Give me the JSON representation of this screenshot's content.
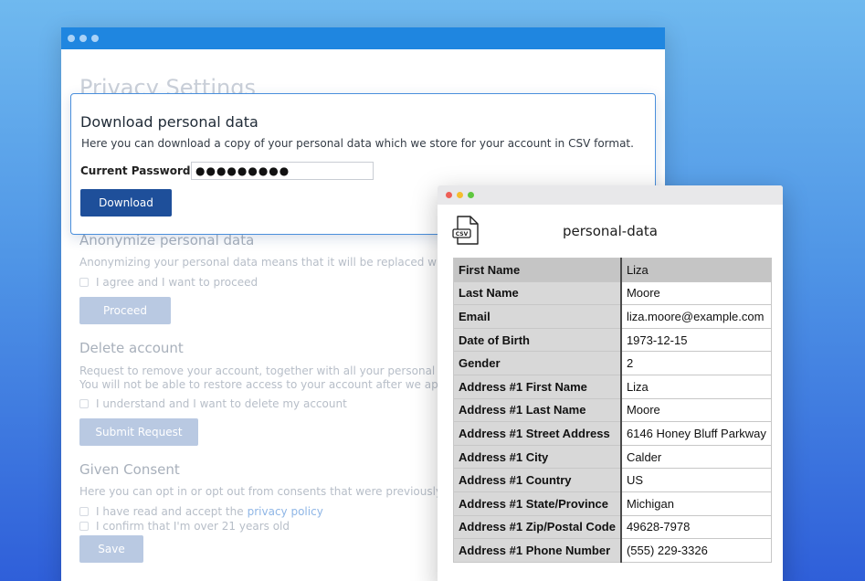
{
  "main": {
    "page_title": "Privacy Settings",
    "download": {
      "title": "Download personal data",
      "description": "Here you can download a copy of your personal data which we store for your account in CSV format.",
      "password_label": "Current Password",
      "required_mark": "*",
      "password_value": "●●●●●●●●●",
      "button": "Download"
    },
    "anonymize": {
      "title": "Anonymize personal data",
      "description": "Anonymizing your personal data means that it will be replaced with no",
      "checkbox": "I agree and I want to proceed",
      "button": "Proceed"
    },
    "delete": {
      "title": "Delete account",
      "line1": "Request to remove your account, together with all your personal data",
      "line2": "You will not be able to restore access to your account after we approve",
      "checkbox": "I understand and I want to delete my account",
      "button": "Submit Request"
    },
    "consent": {
      "title": "Given Consent",
      "description": "Here you can opt in or opt out from consents that were previously give",
      "checkbox1_prefix": "I have read and accept the",
      "checkbox1_link": "privacy policy",
      "checkbox2": "I confirm that I'm over 21 years old",
      "button": "Save"
    }
  },
  "data_window": {
    "icon": "csv-file-icon",
    "icon_label": "CSV",
    "filename": "personal-data",
    "rows": [
      {
        "key": "First Name",
        "value": "Liza"
      },
      {
        "key": "Last Name",
        "value": "Moore"
      },
      {
        "key": "Email",
        "value": "liza.moore@example.com"
      },
      {
        "key": "Date of Birth",
        "value": "1973-12-15"
      },
      {
        "key": "Gender",
        "value": "2"
      },
      {
        "key": "Address #1 First Name",
        "value": "Liza"
      },
      {
        "key": "Address #1 Last Name",
        "value": "Moore"
      },
      {
        "key": "Address #1 Street Address",
        "value": "6146 Honey Bluff Parkway"
      },
      {
        "key": "Address #1 City",
        "value": "Calder"
      },
      {
        "key": "Address #1 Country",
        "value": "US"
      },
      {
        "key": "Address #1 State/Province",
        "value": "Michigan"
      },
      {
        "key": "Address #1 Zip/Postal Code",
        "value": "49628-7978"
      },
      {
        "key": "Address #1 Phone Number",
        "value": "(555) 229-3326"
      }
    ]
  },
  "colors": {
    "main_titlebar": "#1f86e0",
    "primary_button": "#1e4f9a",
    "disabled_button": "#b9c9e2",
    "dialog_border": "#4a8fdc",
    "traffic_red": "#ee5f57",
    "traffic_yellow": "#f5bd2e",
    "traffic_green": "#5fc73f"
  }
}
